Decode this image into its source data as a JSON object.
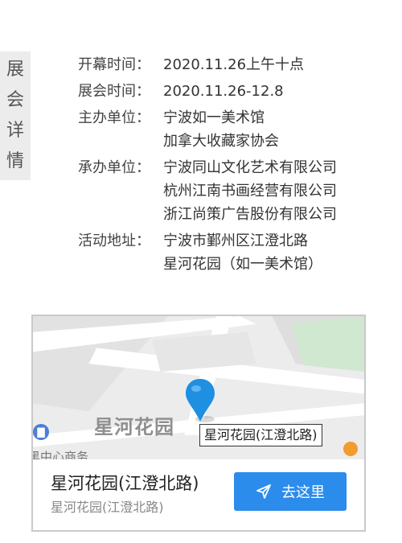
{
  "side_tab": {
    "chars": [
      "展",
      "会",
      "详",
      "情"
    ]
  },
  "info": {
    "opening": {
      "label": "开幕时间：",
      "value": "2020.11.26上午十点"
    },
    "exhibition": {
      "label": "展会时间：",
      "value": "2020.11.26-12.8"
    },
    "organizer": {
      "label": "主办单位：",
      "values": [
        "宁波如一美术馆",
        "加拿大收藏家协会"
      ]
    },
    "co_organizer": {
      "label": "承办单位：",
      "values": [
        "宁波同山文化艺术有限公司",
        "杭州江南书画经营有限公司",
        "浙江尚策广告股份有限公司"
      ]
    },
    "address": {
      "label": "活动地址：",
      "values": [
        "宁波市鄞州区江澄北路",
        "星河花园（如一美术馆）"
      ]
    }
  },
  "map": {
    "place_label_big": "星河花园",
    "place_chip": "星河花园(江澄北路)",
    "poi_left": "黑中心商务",
    "pin_color": "#1e8fe1"
  },
  "destination": {
    "title": "星河花园(江澄北路)",
    "subtitle": "星河花园(江澄北路)",
    "button_label": "去这里",
    "button_color": "#2b8ceb"
  }
}
